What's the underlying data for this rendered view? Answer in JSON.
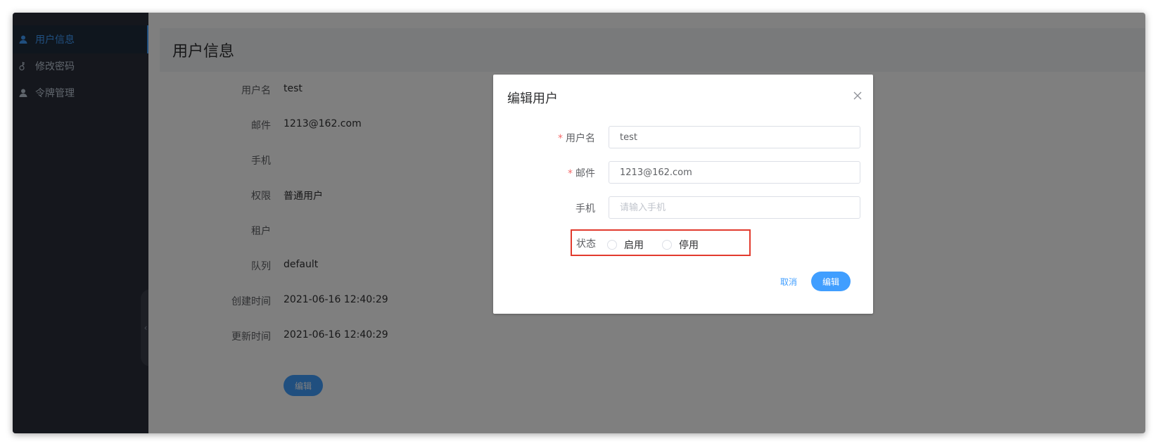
{
  "sidebar": {
    "items": [
      {
        "label": "用户信息",
        "icon": "user-icon",
        "active": true
      },
      {
        "label": "修改密码",
        "icon": "key-icon",
        "active": false
      },
      {
        "label": "令牌管理",
        "icon": "user-icon",
        "active": false
      }
    ],
    "collapse_glyph": "‹"
  },
  "page": {
    "title": "用户信息",
    "fields": [
      {
        "label": "用户名",
        "value": "test"
      },
      {
        "label": "邮件",
        "value": "1213@162.com"
      },
      {
        "label": "手机",
        "value": ""
      },
      {
        "label": "权限",
        "value": "普通用户"
      },
      {
        "label": "租户",
        "value": ""
      },
      {
        "label": "队列",
        "value": "default"
      },
      {
        "label": "创建时间",
        "value": "2021-06-16 12:40:29"
      },
      {
        "label": "更新时间",
        "value": "2021-06-16 12:40:29"
      }
    ],
    "edit_label": "编辑"
  },
  "dialog": {
    "title": "编辑用户",
    "close_glyph": "×",
    "fields": {
      "username": {
        "label": "用户名",
        "required": true,
        "value": "test",
        "placeholder": ""
      },
      "email": {
        "label": "邮件",
        "required": true,
        "value": "1213@162.com",
        "placeholder": ""
      },
      "phone": {
        "label": "手机",
        "required": false,
        "value": "",
        "placeholder": "请输入手机"
      }
    },
    "required_mark": "*",
    "status": {
      "label": "状态",
      "options": [
        "启用",
        "停用"
      ],
      "selected": null
    },
    "cancel_label": "取消",
    "confirm_label": "编辑"
  },
  "colors": {
    "accent": "#409eff",
    "sidebar_bg": "#2b2f3a",
    "highlight_border": "#e23b2e",
    "required": "#f56c6c"
  }
}
